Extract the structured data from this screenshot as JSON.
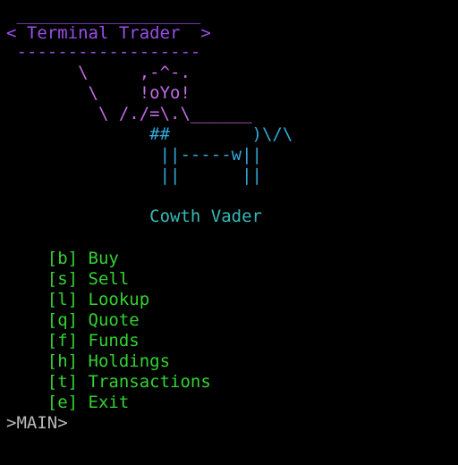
{
  "banner": {
    "top_rule": " __________________",
    "title_line": "< Terminal Trader  >",
    "bottom_rule": " ------------------"
  },
  "cow": {
    "line1": "       \\     ,-^-.",
    "line2": "        \\    !oYo!",
    "line3": "         \\ /./=\\.\\______",
    "line4": "              ##        )\\/\\",
    "line5": "               ||-----w||",
    "line6": "               ||      ||",
    "caption": "              Cowth Vader"
  },
  "menu": {
    "items": [
      {
        "key": "[b]",
        "label": "Buy"
      },
      {
        "key": "[s]",
        "label": "Sell"
      },
      {
        "key": "[l]",
        "label": "Lookup"
      },
      {
        "key": "[q]",
        "label": "Quote"
      },
      {
        "key": "[f]",
        "label": "Funds"
      },
      {
        "key": "[h]",
        "label": "Holdings"
      },
      {
        "key": "[t]",
        "label": "Transactions"
      },
      {
        "key": "[e]",
        "label": "Exit"
      }
    ]
  },
  "prompt": {
    "text": ">MAIN>"
  },
  "colors": {
    "banner": "#9b4fe8",
    "cow": "#c36be3",
    "cow_accent": "#35a8d9",
    "caption": "#37b9b9",
    "menu": "#33d233",
    "background": "#000000"
  }
}
